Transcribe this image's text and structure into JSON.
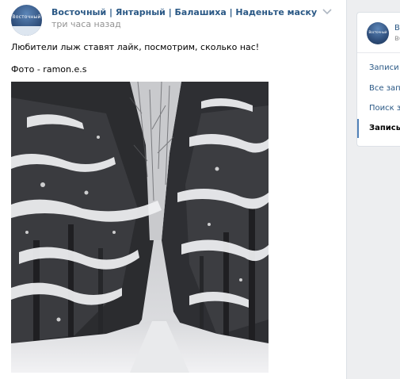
{
  "post": {
    "group_name": "Восточный | Янтарный | Балашиха | Наденьте маску",
    "time": "три часа назад",
    "avatar_text": "Восточный",
    "text_line1": "Любители лыж ставят лайк, посмотрим, сколько нас!",
    "text_line2": "Фото - ramon.e.s"
  },
  "sidebar": {
    "avatar_text": "Восточный",
    "name": "Во",
    "sub": "ве",
    "items": [
      {
        "label": "Записи с"
      },
      {
        "label": "Все запи"
      },
      {
        "label": "Поиск за"
      },
      {
        "label": "Запись и"
      }
    ]
  },
  "colors": {
    "link": "#2a5885",
    "muted": "#939393",
    "background": "#edeef0",
    "accent": "#5181b8"
  }
}
